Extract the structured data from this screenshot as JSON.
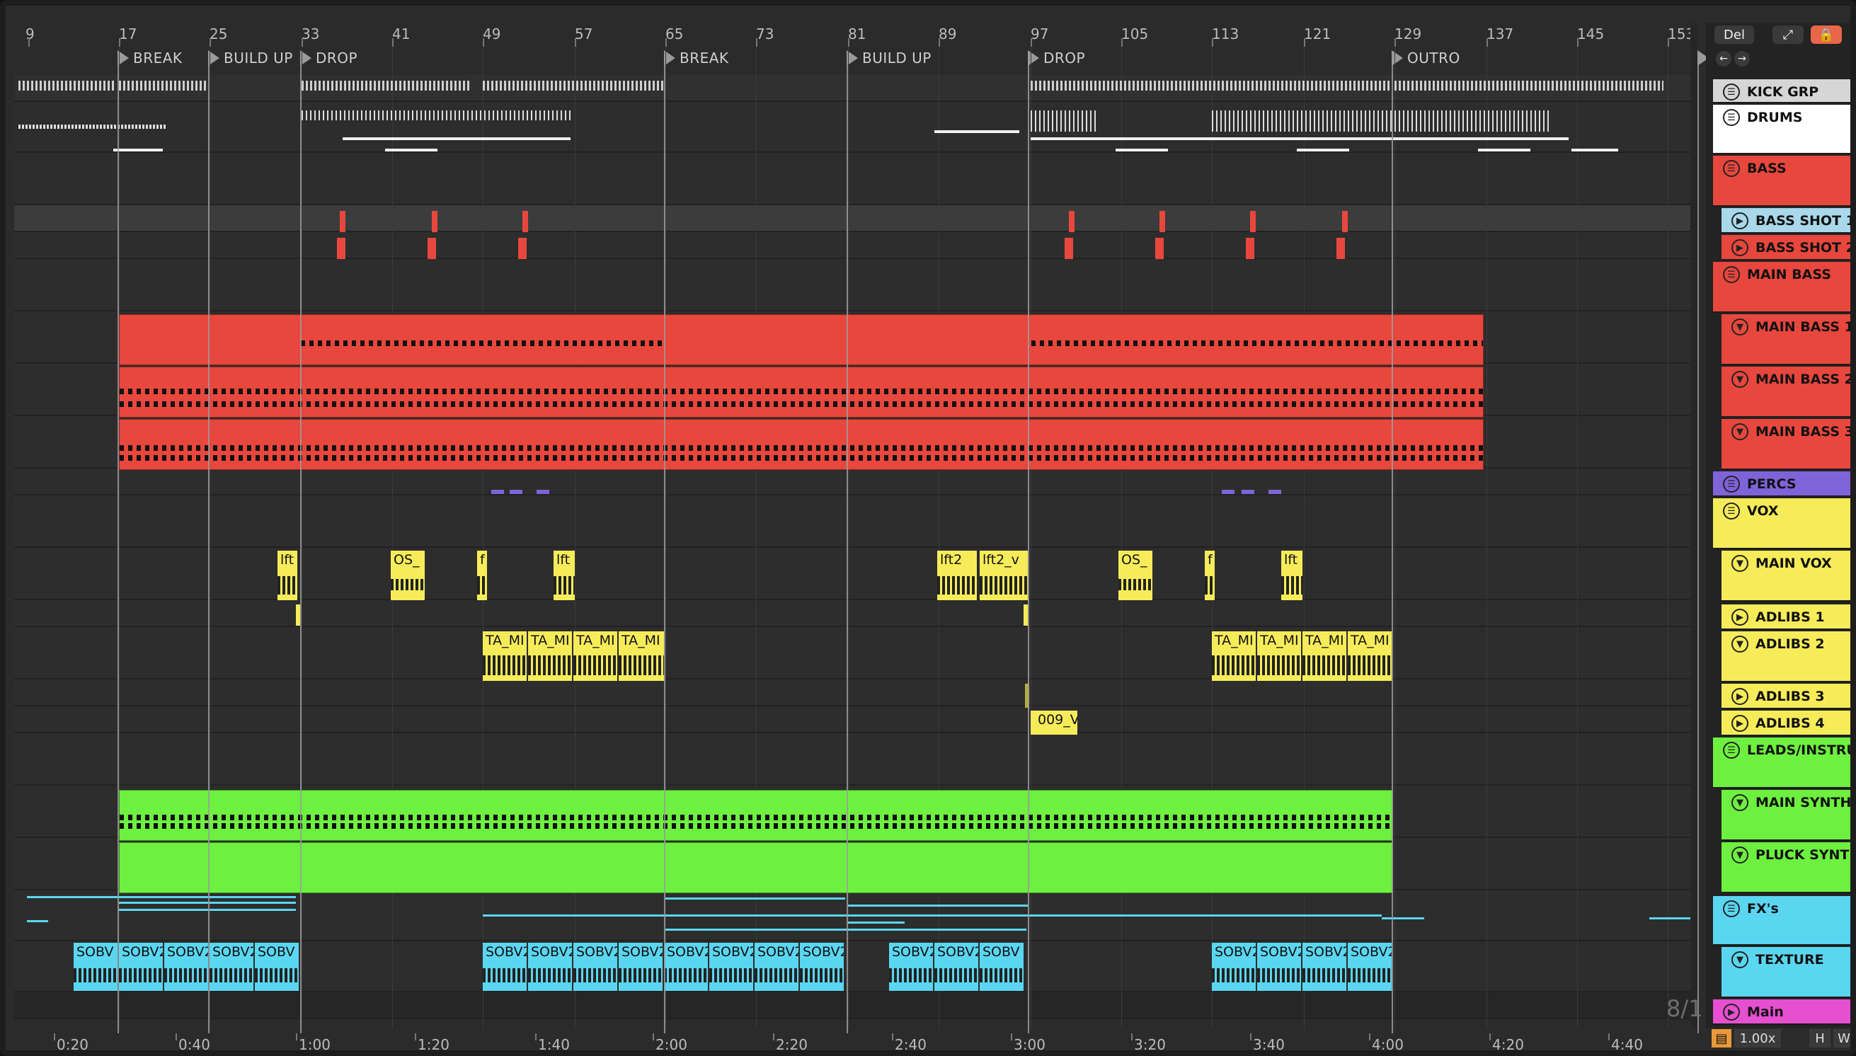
{
  "ruler": {
    "bars": [
      "9",
      "17",
      "25",
      "33",
      "41",
      "49",
      "57",
      "65",
      "73",
      "81",
      "89",
      "97",
      "105",
      "113",
      "121",
      "129",
      "137",
      "145",
      "153"
    ]
  },
  "locators": [
    "BREAK",
    "BUILD UP",
    "DROP",
    "BREAK",
    "BUILD UP",
    "DROP",
    "OUTRO"
  ],
  "timeline": {
    "times": [
      "0:20",
      "0:40",
      "1:00",
      "1:20",
      "1:40",
      "2:00",
      "2:20",
      "2:40",
      "3:00",
      "3:20",
      "3:40",
      "4:00",
      "4:20",
      "4:40"
    ]
  },
  "side": {
    "del_label": "Del",
    "page_count": "8/1",
    "zoom": "1.00x",
    "h_label": "H",
    "w_label": "W"
  },
  "tracks": [
    {
      "name": "KICK GRP",
      "color": "#d6d6d6",
      "kind": "group"
    },
    {
      "name": "DRUMS",
      "color": "#ffffff",
      "kind": "group"
    },
    {
      "name": "BASS",
      "color": "#e8473e",
      "kind": "group"
    },
    {
      "name": "BASS SHOT 1",
      "color": "#a8d8ea",
      "kind": "track"
    },
    {
      "name": "BASS SHOT 2",
      "color": "#e8473e",
      "kind": "track"
    },
    {
      "name": "MAIN BASS",
      "color": "#e8473e",
      "kind": "group"
    },
    {
      "name": "MAIN BASS 1",
      "color": "#e8473e",
      "kind": "midi"
    },
    {
      "name": "MAIN BASS 2",
      "color": "#e8473e",
      "kind": "midi"
    },
    {
      "name": "MAIN BASS 3",
      "color": "#e8473e",
      "kind": "midi"
    },
    {
      "name": "PERCS",
      "color": "#7f63d9",
      "kind": "group"
    },
    {
      "name": "VOX",
      "color": "#f6ec5a",
      "kind": "group"
    },
    {
      "name": "MAIN VOX",
      "color": "#f6ec5a",
      "kind": "midi"
    },
    {
      "name": "ADLIBS 1",
      "color": "#f6ec5a",
      "kind": "track"
    },
    {
      "name": "ADLIBS 2",
      "color": "#f6ec5a",
      "kind": "midi"
    },
    {
      "name": "ADLIBS 3",
      "color": "#f6ec5a",
      "kind": "track"
    },
    {
      "name": "ADLIBS 4",
      "color": "#f6ec5a",
      "kind": "track"
    },
    {
      "name": "LEADS/INSTRU",
      "color": "#6ef040",
      "kind": "group"
    },
    {
      "name": "MAIN SYNTH",
      "color": "#6ef040",
      "kind": "midi"
    },
    {
      "name": "PLUCK SYNTH",
      "color": "#6ef040",
      "kind": "midi"
    },
    {
      "name": "FX's",
      "color": "#5ad6f0",
      "kind": "group"
    },
    {
      "name": "TEXTURE",
      "color": "#5ad6f0",
      "kind": "midi"
    },
    {
      "name": "Main",
      "color": "#e64fd0",
      "kind": "track"
    }
  ],
  "clips": {
    "vox_main": [
      "lft",
      "OS_",
      "f",
      "lft",
      "lft2",
      "lft2_v",
      "OS_",
      "f",
      "lft"
    ],
    "adlibs2": [
      "TA_MI",
      "TA_MI",
      "TA_MI",
      "TA_MI",
      "TA_MI",
      "TA_MI",
      "TA_MI",
      "TA_MI"
    ],
    "adlibs4": [
      "009_V"
    ],
    "texture": [
      "SOBV",
      "SOBV2",
      "SOBV2",
      "SOBV2",
      "SOBV",
      "SOBV2",
      "SOBV2",
      "SOBV2",
      "SOBV2",
      "SOBV2",
      "SOBV2",
      "SOBV2",
      "SOBV2",
      "SOBV2",
      "SOBV2",
      "SOBV",
      "SOBV2",
      "SOBV2",
      "SOBV2",
      "SOBV2"
    ]
  },
  "colors": {
    "bass": "#e8473e",
    "vox": "#f6ec5a",
    "leads": "#6ef040",
    "fx": "#5ad6f0",
    "percs": "#7f63d9",
    "main": "#e64fd0",
    "zoom_box": "#4fa8c8",
    "lock_button": "#e8664a"
  }
}
